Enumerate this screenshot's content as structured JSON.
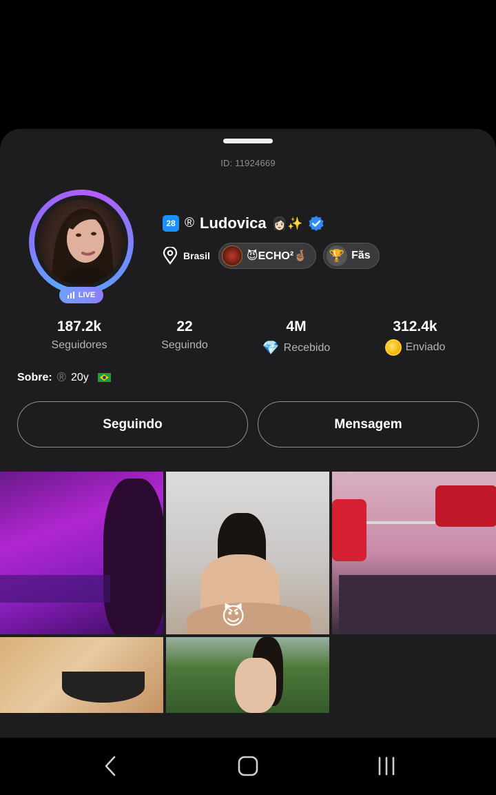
{
  "profile": {
    "id_text": "ID: 11924669",
    "live_label": "LIVE",
    "level": "28",
    "reg_mark": "®",
    "name": "Ludovica",
    "name_emojis": "👩🏻✨",
    "location": "Brasil",
    "family_tag": "😈ECHO²🤞🏽",
    "fans_label": "Fãs"
  },
  "stats": [
    {
      "value": "187.2k",
      "label": "Seguidores"
    },
    {
      "value": "22",
      "label": "Seguindo"
    },
    {
      "value": "4M",
      "label": "Recebido",
      "icon": "diamond-icon"
    },
    {
      "value": "312.4k",
      "label": "Enviado",
      "icon": "coin-icon"
    }
  ],
  "about": {
    "label": "Sobre:",
    "reg_mark": "®",
    "text": "20y",
    "flag": "brazil-flag"
  },
  "actions": {
    "following_label": "Seguindo",
    "message_label": "Mensagem"
  },
  "gallery": {
    "count": 5,
    "sticker": "😈"
  },
  "colors": {
    "sheet_bg": "#1d1d1f",
    "accent_blue": "#1e8fff",
    "ring_gradient": [
      "#5aa9ff",
      "#8f6bff",
      "#b45cff"
    ]
  }
}
